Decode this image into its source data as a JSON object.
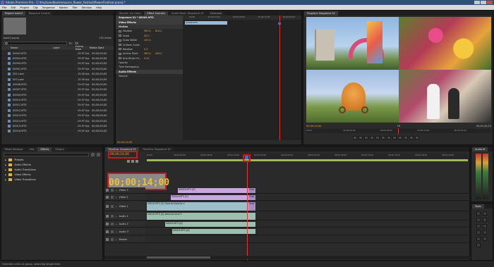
{
  "window": {
    "title": "Adobe Premiere Pro - C:\\tmp\\sandbox\\resource_flower_festival\\flowerFestival.prproj *"
  },
  "menu": [
    "File",
    "Edit",
    "Project",
    "Clip",
    "Sequence",
    "Marker",
    "Title",
    "Window",
    "Help"
  ],
  "project_panel": {
    "tabs": [
      "Project: back3",
      "Resource Central"
    ],
    "project_name": "back3.prproj",
    "item_count": "192 Items",
    "search_label": "In:",
    "search_scope": "All",
    "columns": [
      "Name",
      "Label",
      "Frame Rate",
      "Media Start"
    ],
    "items": [
      {
        "name": "00003.MTS",
        "fps": "29.97 fps",
        "start": "00;00;00;00"
      },
      {
        "name": "00004.MTS",
        "fps": "29.97 fps",
        "start": "00;00;00;00"
      },
      {
        "name": "00005.MTS",
        "fps": "29.97 fps",
        "start": "00;00;00;00"
      },
      {
        "name": "00001.MTS",
        "fps": "29.97 fps",
        "start": "00;00;00;00"
      },
      {
        "name": "002.Lwei",
        "fps": "15.00 fps",
        "start": "00;00;00;00"
      },
      {
        "name": "003.Lwei",
        "fps": "15.00 fps",
        "start": "00;00;00;00"
      },
      {
        "name": "00006.MTS",
        "fps": "29.97 fps",
        "start": "00;00;00;00"
      },
      {
        "name": "00007.MTS",
        "fps": "29.97 fps",
        "start": "00;00;00;00"
      },
      {
        "name": "00009.MTS",
        "fps": "29.97 fps",
        "start": "00;00;00;00"
      },
      {
        "name": "00010.MTS",
        "fps": "29.97 fps",
        "start": "00;00;00;00"
      },
      {
        "name": "00011.MTS",
        "fps": "29.97 fps",
        "start": "00;00;00;00"
      },
      {
        "name": "00012.MTS",
        "fps": "29.97 fps",
        "start": "00;00;00;00"
      },
      {
        "name": "00013.MTS",
        "fps": "29.97 fps",
        "start": "00;00;00;00"
      },
      {
        "name": "00014.MTS",
        "fps": "29.97 fps",
        "start": "00;00;00;00"
      },
      {
        "name": "00015.MTS",
        "fps": "29.97 fps",
        "start": "00;00;00;00"
      },
      {
        "name": "00016.MTS",
        "fps": "29.97 fps",
        "start": "00;00;00;00"
      }
    ]
  },
  "effect_controls": {
    "tabs": [
      "Source: (no clips)",
      "Effect Controls",
      "Audio Mixer: Sequence 01",
      "Metadata"
    ],
    "header": "Sequence 01 * 00009.MTS",
    "clip_label": "00009.MTS",
    "video_effects": "Video Effects",
    "motion": "Motion",
    "props": [
      {
        "k": "Position",
        "v1": "960.0",
        "v2": "810.0"
      },
      {
        "k": "Scale",
        "v1": "50.0",
        "v2": ""
      },
      {
        "k": "Scale Width",
        "v1": "100.0",
        "v2": ""
      },
      {
        "k": "Uniform Scale",
        "v1": "",
        "v2": ""
      },
      {
        "k": "Rotation",
        "v1": "0.0",
        "v2": ""
      },
      {
        "k": "Anchor Point",
        "v1": "960.0",
        "v2": "540.0"
      },
      {
        "k": "Anti-flicker Fil...",
        "v1": "0.00",
        "v2": ""
      }
    ],
    "opacity": "Opacity",
    "time_remapping": "Time Remapping",
    "audio_effects": "Audio Effects",
    "volume": "Volume",
    "timecode": "00;00;14;00"
  },
  "program_monitor": {
    "tab": "Program: Sequence 01",
    "timecode": "00;00;14;00",
    "fit": "Fit",
    "duration": "00;00;18;10",
    "ruler": [
      "00;00",
      "00;00;04;00",
      "00;00;08;00",
      "00;00;12;00",
      "00;00;16;00"
    ]
  },
  "effects_panel": {
    "tabs": [
      "Media Browser",
      "Info",
      "Effects",
      "History"
    ],
    "items": [
      "Presets",
      "Audio Effects",
      "Audio Transitions",
      "Video Effects",
      "Video Transitions"
    ]
  },
  "timeline": {
    "tabs": [
      "Timeline: Sequence 01",
      "Timeline: Sequence 02"
    ],
    "timecode_small": "00;00;14;00",
    "timecode_big": "00;00;14;00",
    "ruler": [
      "00;00",
      "00;00;04;00",
      "00;00;08;00",
      "00;00;12;00",
      "00;00;16;00",
      "00;00;20;00",
      "00;00;24;00",
      "00;00;28;00",
      "00;00;32;00",
      "00;00;36;00",
      "00;00;40;00",
      "00;00;44;00"
    ],
    "tracks": [
      {
        "name": "Video 3"
      },
      {
        "name": "Video 2"
      },
      {
        "name": "Video 1"
      },
      {
        "name": "Audio 1"
      },
      {
        "name": "Audio 2"
      },
      {
        "name": "Audio 3"
      },
      {
        "name": "Master"
      }
    ],
    "clips": {
      "v3": "00009.MTS [V]",
      "v3_cross": "Cros",
      "v2": "00004.MTS [V]",
      "v2_cross": "Cros",
      "v1": "00010.MTS [V]  Opacity:Opacity ▾",
      "v1_cross": "Cros",
      "a1": "00010.MTS [A]  Volume:Level ▾",
      "a2": "00004.MTS [A]",
      "a3": "00009.MTS [A]"
    }
  },
  "audio_meters": {
    "tab": "Audio M"
  },
  "tools": {
    "tab": "Tools"
  },
  "status": "Drag to ripple edit. Use Ctrl to override one side of the edit. Click to select a link or group, selecting single item.",
  "status_short": "Override a link or group, selecting single item."
}
